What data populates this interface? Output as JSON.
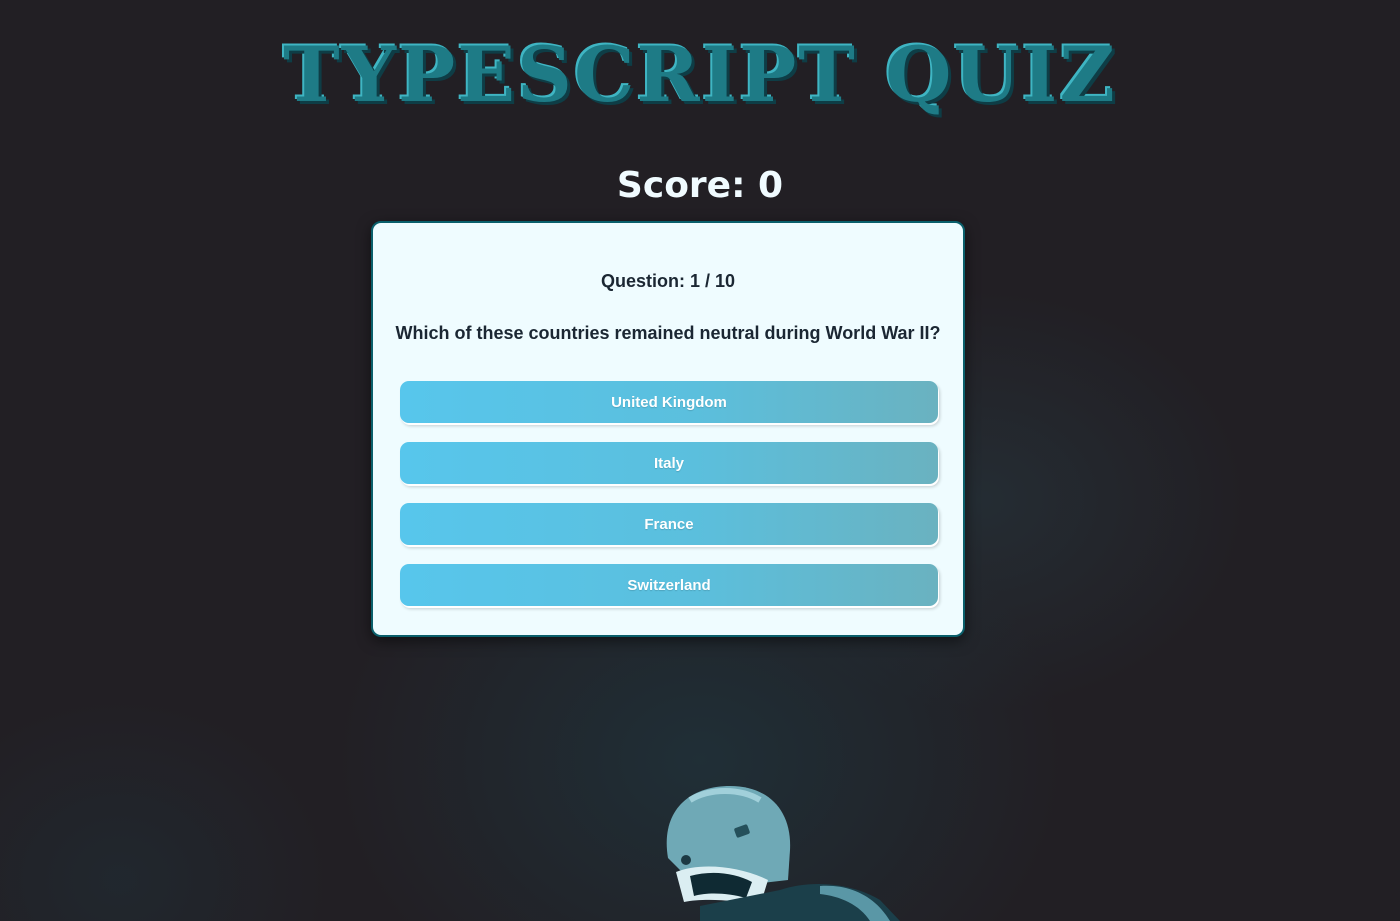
{
  "header": {
    "title": "TYPESCRIPT QUIZ"
  },
  "score": {
    "text": "Score: 0"
  },
  "quiz": {
    "question_number": "Question: 1 / 10",
    "question": "Which of these countries remained neutral during World War II?",
    "answers": [
      {
        "label": "United Kingdom"
      },
      {
        "label": "Italy"
      },
      {
        "label": "France"
      },
      {
        "label": "Switzerland"
      }
    ]
  },
  "colors": {
    "background": "#221f24",
    "title": "#1e7b86",
    "card": "#effcff",
    "answer_button": "#57c6ec",
    "text_dark": "#1b2733"
  }
}
